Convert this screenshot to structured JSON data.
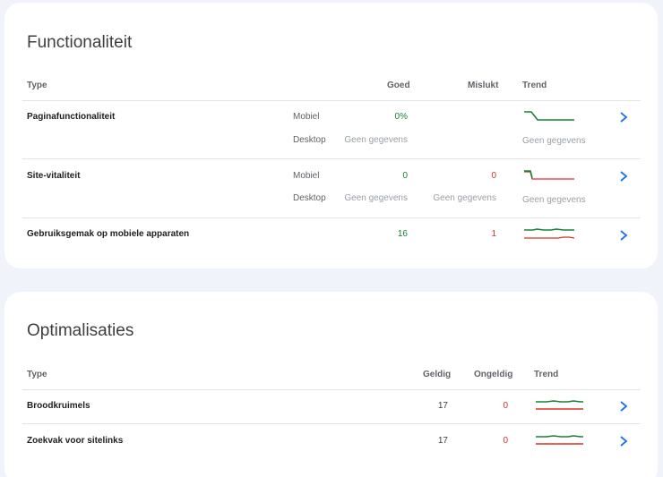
{
  "functionaliteit": {
    "title": "Functionaliteit",
    "headers": {
      "type": "Type",
      "goed": "Goed",
      "mislukt": "Mislukt",
      "trend": "Trend"
    },
    "rows": [
      {
        "name": "Paginafunctionaliteit",
        "mobile": {
          "label": "Mobiel",
          "goed": "0%",
          "mislukt": ""
        },
        "desktop": {
          "label": "Desktop",
          "goed": "Geen gegevens",
          "trend": "Geen gegevens"
        }
      },
      {
        "name": "Site-vitaliteit",
        "mobile": {
          "label": "Mobiel",
          "goed": "0",
          "mislukt": "0"
        },
        "desktop": {
          "label": "Desktop",
          "goed": "Geen gegevens",
          "mislukt": "Geen gegevens",
          "trend": "Geen gegevens"
        }
      },
      {
        "name": "Gebruiksgemak op mobiele apparaten",
        "goed": "16",
        "mislukt": "1"
      }
    ]
  },
  "optimalisaties": {
    "title": "Optimalisaties",
    "headers": {
      "type": "Type",
      "geldig": "Geldig",
      "ongeldig": "Ongeldig",
      "trend": "Trend"
    },
    "rows": [
      {
        "name": "Broodkruimels",
        "geldig": "17",
        "ongeldig": "0"
      },
      {
        "name": "Zoekvak voor sitelinks",
        "geldig": "17",
        "ongeldig": "0"
      }
    ]
  },
  "colors": {
    "good": "#188038",
    "bad": "#d93025",
    "chevron": "#1a73e8",
    "background": "#f1f3fb"
  },
  "icons": {
    "row_action": "chevron-right-icon"
  }
}
